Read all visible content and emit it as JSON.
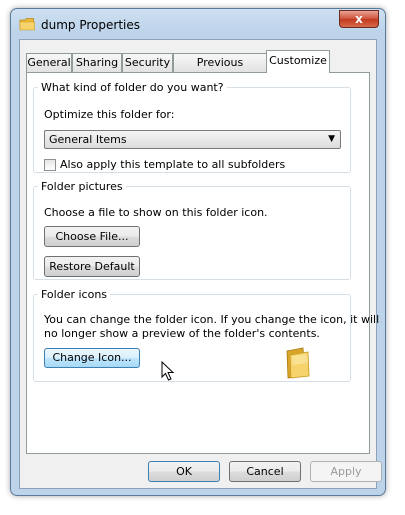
{
  "window": {
    "title": "dump Properties",
    "close_glyph": "x",
    "folder_icon": "folder-icon"
  },
  "tabs": [
    {
      "label": "General",
      "active": false
    },
    {
      "label": "Sharing",
      "active": false
    },
    {
      "label": "Security",
      "active": false
    },
    {
      "label": "Previous Versions",
      "active": false
    },
    {
      "label": "Customize",
      "active": true
    }
  ],
  "folder_type": {
    "legend": "What kind of folder do you want?",
    "optimize_label": "Optimize this folder for:",
    "selected": "General Items",
    "apply_subfolders_label": "Also apply this template to all subfolders",
    "apply_subfolders_checked": false
  },
  "folder_pictures": {
    "legend": "Folder pictures",
    "description": "Choose a file to show on this folder icon.",
    "choose_file_label": "Choose File...",
    "restore_default_label": "Restore Default"
  },
  "folder_icons": {
    "legend": "Folder icons",
    "description_line1": "You can change the folder icon. If you change the icon, it will",
    "description_line2": "no longer show a preview of the folder's contents.",
    "change_icon_label": "Change Icon..."
  },
  "footer": {
    "ok_label": "OK",
    "cancel_label": "Cancel",
    "apply_label": "Apply",
    "apply_enabled": false
  },
  "colors": {
    "titlebar": "#bcd3ea",
    "close_button": "#c23a1f",
    "hot_button": "#bee6fd",
    "folder_yellow": "#f2c94c"
  }
}
